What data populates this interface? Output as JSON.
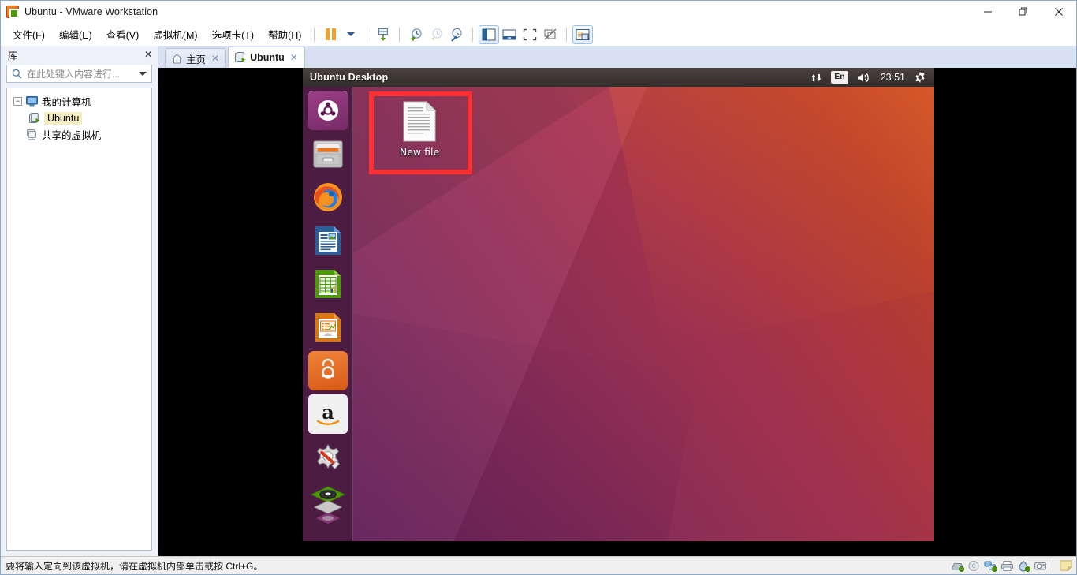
{
  "window": {
    "title": "Ubuntu - VMware Workstation",
    "app_icon": "vmware-ubuntu-icon",
    "controls": {
      "minimize": "—",
      "restore": "❐",
      "close": "✕"
    }
  },
  "menubar": {
    "items": [
      {
        "label": "文件(F)",
        "name": "menu-file"
      },
      {
        "label": "编辑(E)",
        "name": "menu-edit"
      },
      {
        "label": "查看(V)",
        "name": "menu-view"
      },
      {
        "label": "虚拟机(M)",
        "name": "menu-vm"
      },
      {
        "label": "选项卡(T)",
        "name": "menu-tabs"
      },
      {
        "label": "帮助(H)",
        "name": "menu-help"
      }
    ]
  },
  "toolbar": {
    "buttons": [
      {
        "name": "suspend-button",
        "icon": "pause-icon",
        "title": "挂起"
      },
      {
        "name": "power-dropdown-button",
        "icon": "chevron-down-icon",
        "title": "电源"
      },
      {
        "name": "manage-snapshot-button",
        "icon": "snapshot-manager-icon",
        "title": "管理快照"
      },
      {
        "name": "take-snapshot-button",
        "icon": "snapshot-add-icon",
        "title": "拍摄快照"
      },
      {
        "name": "revert-snapshot-button",
        "icon": "snapshot-revert-icon",
        "title": "恢复快照"
      },
      {
        "name": "snapshot-manager-button",
        "icon": "snapshot-settings-icon",
        "title": "快照管理器"
      },
      {
        "name": "show-library-button",
        "icon": "library-panel-icon",
        "title": "显示或隐藏库",
        "pressed": true
      },
      {
        "name": "show-thumbnail-bar-button",
        "icon": "thumbnail-bar-icon",
        "title": "显示缩略图栏"
      },
      {
        "name": "fullscreen-button",
        "icon": "fullscreen-icon",
        "title": "进入全屏"
      },
      {
        "name": "unity-mode-button",
        "icon": "unity-mode-icon",
        "title": "Unity 模式"
      },
      {
        "name": "console-view-button",
        "icon": "console-view-icon",
        "title": "控制台视图",
        "pressed": true
      }
    ]
  },
  "sidebar": {
    "title": "库",
    "close_label": "✕",
    "search": {
      "placeholder": "在此处键入内容进行...",
      "value": "",
      "icon": "search-icon",
      "dropdown_icon": "chevron-down-icon"
    },
    "tree": [
      {
        "label": "我的计算机",
        "icon": "computer-icon",
        "expander": "−",
        "level": 0,
        "selected": false
      },
      {
        "label": "Ubuntu",
        "icon": "vm-running-icon",
        "level": 1,
        "selected": true
      },
      {
        "label": "共享的虚拟机",
        "icon": "shared-vm-icon",
        "level": 0,
        "selected": false
      }
    ]
  },
  "tabs": [
    {
      "label": "主页",
      "icon": "home-icon",
      "active": false,
      "close": "✕"
    },
    {
      "label": "Ubuntu",
      "icon": "vm-running-icon",
      "active": true,
      "close": "✕"
    }
  ],
  "vm": {
    "panel": {
      "title": "Ubuntu Desktop",
      "indicators": [
        {
          "name": "network-indicator",
          "icon": "network-arrows-icon"
        },
        {
          "name": "keyboard-indicator",
          "icon": "keyboard-layout-icon",
          "label": "En"
        },
        {
          "name": "sound-indicator",
          "icon": "volume-icon"
        },
        {
          "name": "clock-indicator",
          "label": "23:51"
        },
        {
          "name": "system-menu-indicator",
          "icon": "gear-icon"
        }
      ]
    },
    "launcher": [
      {
        "name": "launcher-item-dash",
        "label": "Dash 主页",
        "icon": "ubuntu-dash-icon"
      },
      {
        "name": "launcher-item-files",
        "label": "文件",
        "icon": "nautilus-files-icon"
      },
      {
        "name": "launcher-item-firefox",
        "label": "Firefox 网络浏览器",
        "icon": "firefox-icon"
      },
      {
        "name": "launcher-item-writer",
        "label": "LibreOffice Writer",
        "icon": "libreoffice-writer-icon"
      },
      {
        "name": "launcher-item-calc",
        "label": "LibreOffice Calc",
        "icon": "libreoffice-calc-icon"
      },
      {
        "name": "launcher-item-impress",
        "label": "LibreOffice Impress",
        "icon": "libreoffice-impress-icon"
      },
      {
        "name": "launcher-item-software",
        "label": "Ubuntu 软件",
        "icon": "ubuntu-software-icon"
      },
      {
        "name": "launcher-item-amazon",
        "label": "Amazon",
        "icon": "amazon-icon"
      },
      {
        "name": "launcher-item-settings",
        "label": "系统设置",
        "icon": "system-settings-icon"
      },
      {
        "name": "launcher-item-workspace",
        "label": "工作区切换器",
        "icon": "workspace-switcher-icon"
      }
    ],
    "desktop_icons": [
      {
        "name": "desktop-file-new-file",
        "label": "New file",
        "icon": "text-document-icon",
        "highlighted": true
      }
    ],
    "annotation": {
      "name": "red-highlight-box",
      "color": "#fc3030"
    }
  },
  "statusbar": {
    "message": "要将输入定向到该虚拟机，请在虚拟机内部单击或按 Ctrl+G。",
    "devices": [
      {
        "name": "hard-disk-status-icon",
        "icon": "hard-disk-icon"
      },
      {
        "name": "cd-dvd-status-icon",
        "icon": "cd-dvd-icon"
      },
      {
        "name": "network-status-icon",
        "icon": "network-icon"
      },
      {
        "name": "printer-status-icon",
        "icon": "printer-icon"
      },
      {
        "name": "usb-status-icon",
        "icon": "usb-icon"
      },
      {
        "name": "camera-status-icon",
        "icon": "camera-icon"
      },
      {
        "name": "notes-status-icon",
        "icon": "note-icon"
      }
    ]
  },
  "colors": {
    "accent_orange": "#dd4814",
    "annotation_red": "#fc3030",
    "tabbar_blue": "#d8e1f2",
    "sidebar_bg": "#eef1f7",
    "panel_dark": "#3c3633",
    "launcher_purple": "#5e2252"
  }
}
